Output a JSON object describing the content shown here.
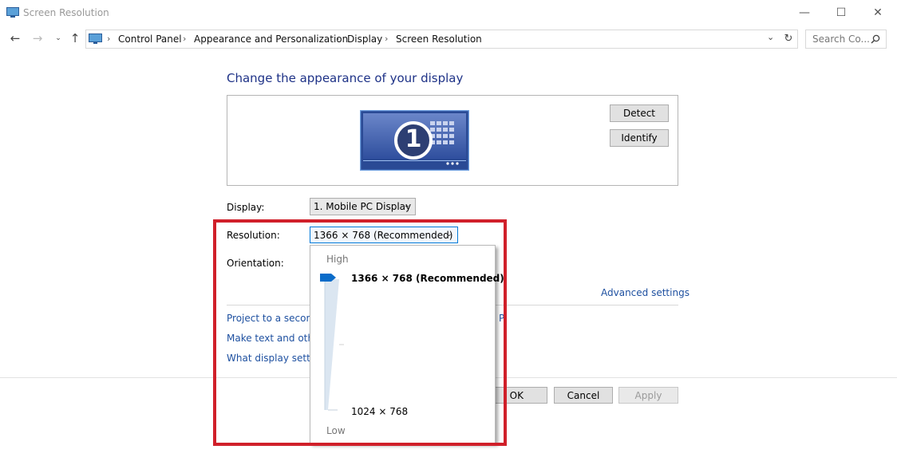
{
  "window": {
    "title": "Screen Resolution",
    "minimize_glyph": "—",
    "maximize_glyph": "☐",
    "close_glyph": "✕"
  },
  "address": {
    "breadcrumbs": [
      "Control Panel",
      "Appearance and Personalization",
      "Display",
      "Screen Resolution"
    ],
    "search_placeholder": "Search Co..."
  },
  "main": {
    "heading": "Change the appearance of your display",
    "detect_label": "Detect",
    "identify_label": "Identify",
    "monitor_number": "1",
    "display_label": "Display:",
    "display_value": "1. Mobile PC Display",
    "resolution_label": "Resolution:",
    "resolution_value": "1366 × 768 (Recommended)",
    "orientation_label": "Orientation:",
    "advanced_settings": "Advanced settings",
    "link_project": "Project to a second",
    "link_project_tail": "P",
    "link_text": "Make text and other",
    "link_what": "What display setting",
    "ok_label": "OK",
    "cancel_label": "Cancel",
    "apply_label": "Apply"
  },
  "popup": {
    "high_label": "High",
    "low_label": "Low",
    "options": [
      "1366 × 768 (Recommended)",
      "1024 × 768"
    ],
    "selected_index": 0
  },
  "colors": {
    "accent": "#1e3287",
    "link": "#1e50a0",
    "highlight": "#d0202a",
    "monitor_blue": "#2f4f9e"
  }
}
